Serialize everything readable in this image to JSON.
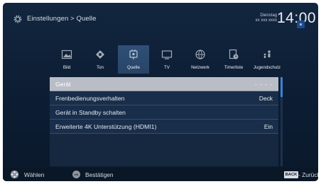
{
  "header": {
    "breadcrumb": "Einstellungen > Quelle",
    "day_label": "Dienstag",
    "date_label": "xx xxx xxxx",
    "time": "14:00"
  },
  "tabs": [
    {
      "label": "Bild",
      "icon": "picture-icon",
      "active": false
    },
    {
      "label": "Ton",
      "icon": "sound-icon",
      "active": false
    },
    {
      "label": "Quelle",
      "icon": "source-icon",
      "active": true
    },
    {
      "label": "TV",
      "icon": "tv-icon",
      "active": false
    },
    {
      "label": "Netzwerk",
      "icon": "network-icon",
      "active": false
    },
    {
      "label": "Timerliste",
      "icon": "timer-list-icon",
      "active": false
    },
    {
      "label": "Jugendschutz",
      "icon": "parental-lock-icon",
      "active": false
    }
  ],
  "list": {
    "items": [
      {
        "label": "Gerät",
        "value": "- - - -",
        "selected": true
      },
      {
        "label": "Frenbedienungsverhalten",
        "value": "Deck",
        "selected": false
      },
      {
        "label": "Gerät in Standby schalten",
        "value": "",
        "selected": false
      },
      {
        "label": "Erweiterte 4K Unterstützung (HDMI1)",
        "value": "Ein",
        "selected": false
      }
    ]
  },
  "footer": {
    "select_label": "Wählen",
    "ok_key": "OK",
    "confirm_label": "Bestätigen",
    "back_key": "BACK",
    "back_label": "- Zurück"
  },
  "colors": {
    "background": "#0d2038",
    "active_tab": "#2f4f76",
    "selected_row": "#b9bec6",
    "scroll_thumb": "#3e82d4"
  }
}
